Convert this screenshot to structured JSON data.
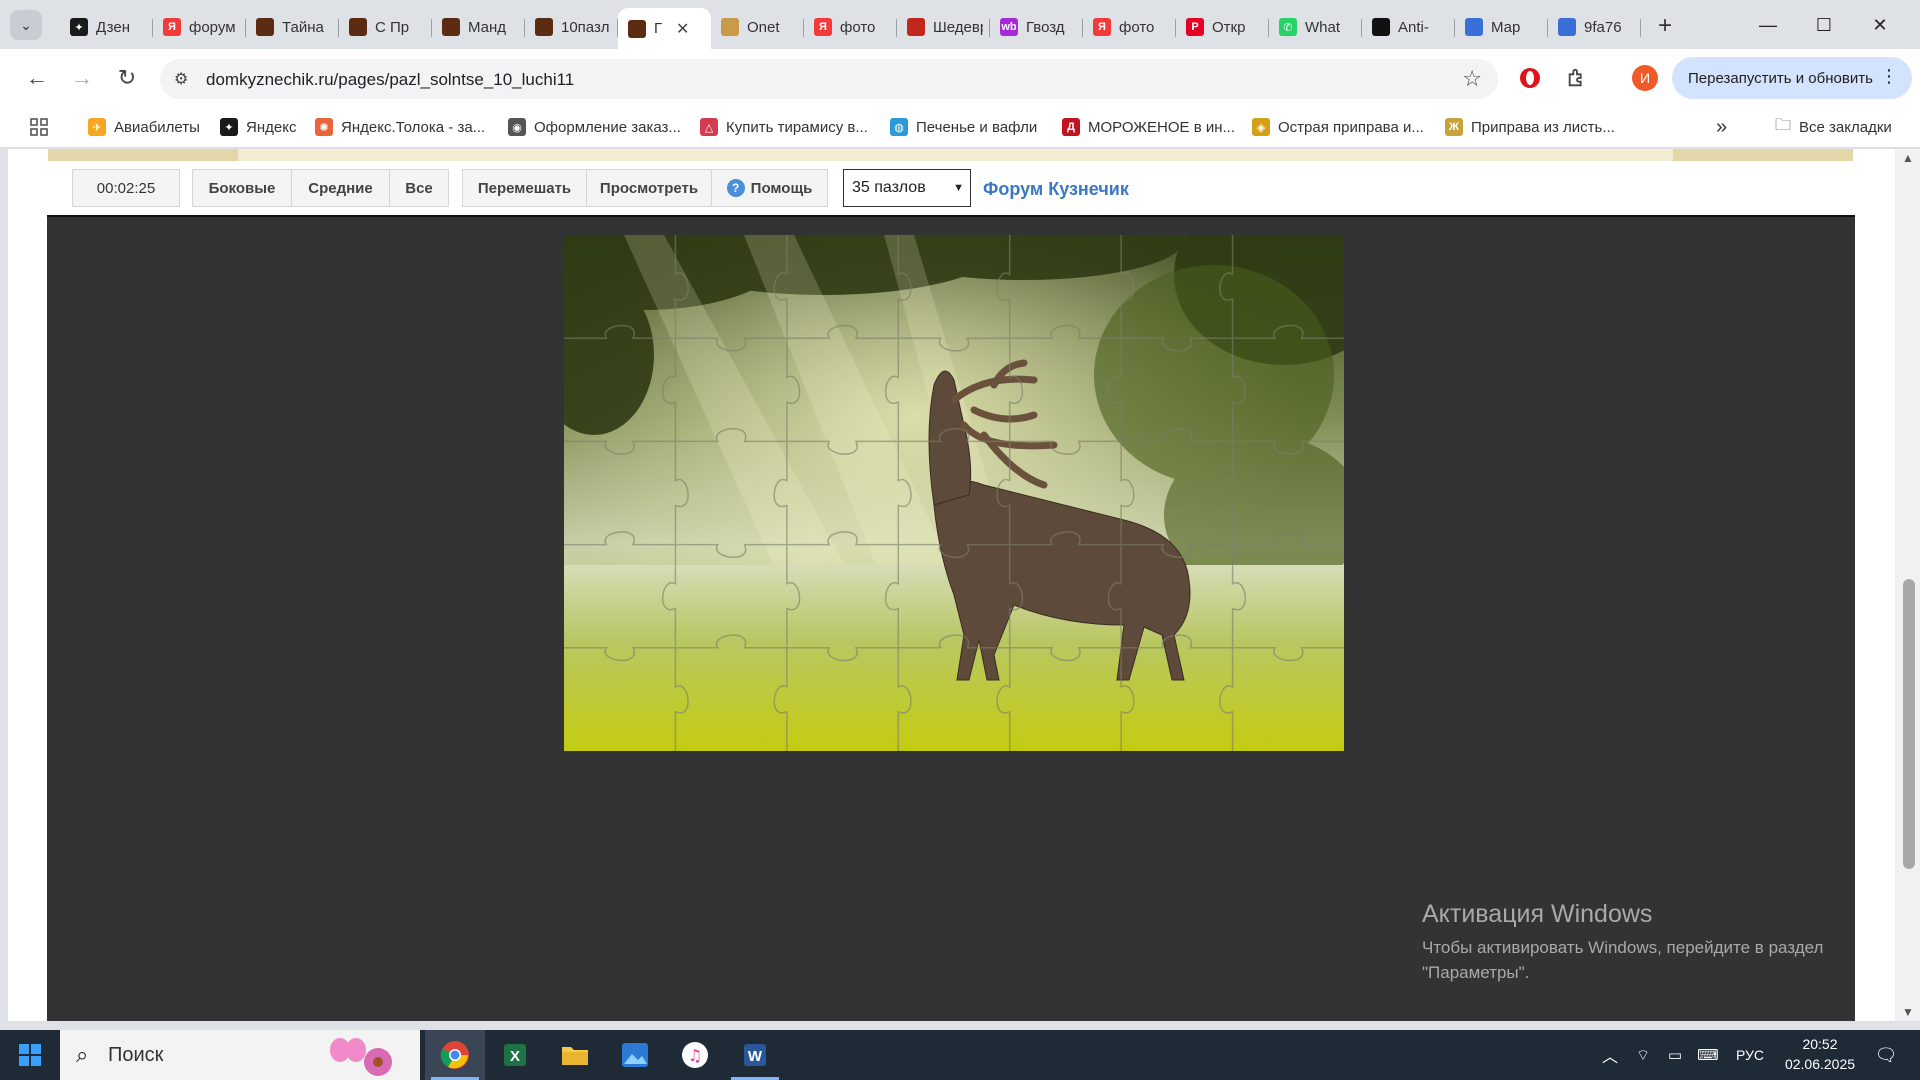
{
  "browser": {
    "tabs": [
      {
        "title": "Дзен",
        "fav_color": "#1a1a1a",
        "fav_glyph": "✦"
      },
      {
        "title": "форум",
        "fav_color": "#f33a3a",
        "fav_glyph": "Я"
      },
      {
        "title": "Тайна",
        "fav_color": "#5b2b12",
        "fav_glyph": ""
      },
      {
        "title": "С Пр",
        "fav_color": "#5b2b12",
        "fav_glyph": ""
      },
      {
        "title": "Манд",
        "fav_color": "#5b2b12",
        "fav_glyph": ""
      },
      {
        "title": "10пазл",
        "fav_color": "#5b2b12",
        "fav_glyph": ""
      },
      {
        "title": "Г",
        "fav_color": "#5b2b12",
        "fav_glyph": "",
        "active": true
      },
      {
        "title": "Onet",
        "fav_color": "#c99a4a",
        "fav_glyph": ""
      },
      {
        "title": "фото",
        "fav_color": "#f33a3a",
        "fav_glyph": "Я"
      },
      {
        "title": "Шедевр",
        "fav_color": "#c0271d",
        "fav_glyph": ""
      },
      {
        "title": "Гвозд",
        "fav_color": "#a52ad6",
        "fav_glyph": "wb"
      },
      {
        "title": "фото",
        "fav_color": "#f33a3a",
        "fav_glyph": "Я"
      },
      {
        "title": "Откр",
        "fav_color": "#e60023",
        "fav_glyph": "P"
      },
      {
        "title": "What",
        "fav_color": "#25d366",
        "fav_glyph": "✆"
      },
      {
        "title": "Anti-",
        "fav_color": "#111111",
        "fav_glyph": ""
      },
      {
        "title": "Мар",
        "fav_color": "#3b6fd8",
        "fav_glyph": ""
      },
      {
        "title": "9fa76",
        "fav_color": "#3b6fd8",
        "fav_glyph": ""
      }
    ],
    "url": "domkyznechik.ru/pages/pazl_solntse_10_luchi11",
    "restart_label": "Перезапустить и обновить",
    "profile_letter": "И",
    "bookmarks": [
      {
        "label": "Авиабилеты",
        "color": "#f5a623",
        "glyph": "✈"
      },
      {
        "label": "Яндекс",
        "color": "#1a1a1a",
        "glyph": "✦"
      },
      {
        "label": "Яндекс.Толока - за...",
        "color": "#e8643c",
        "glyph": "✺"
      },
      {
        "label": "Оформление заказ...",
        "color": "#555555",
        "glyph": "◉"
      },
      {
        "label": "Купить тирамису в...",
        "color": "#d33b4e",
        "glyph": "△"
      },
      {
        "label": "Печенье и вафли",
        "color": "#2b9ad6",
        "glyph": "◍"
      },
      {
        "label": "МОРОЖЕНОЕ в ин...",
        "color": "#c1121f",
        "glyph": "Д"
      },
      {
        "label": "Острая приправа и...",
        "color": "#d4a017",
        "glyph": "◈"
      },
      {
        "label": "Приправа из листь...",
        "color": "#c8a23c",
        "glyph": "Ж"
      }
    ],
    "all_bookmarks": "Все закладки",
    "more": "»"
  },
  "puzzle_page": {
    "timer": "00:02:25",
    "buttons": {
      "side": "Боковые",
      "middle": "Средние",
      "all": "Все",
      "shuffle": "Перемешать",
      "preview": "Просмотреть",
      "help": "Помощь"
    },
    "pieces_selected": "35 пазлов",
    "forum_link": "Форум Кузнечик",
    "grid": {
      "cols": 7,
      "rows": 5
    }
  },
  "activation": {
    "title": "Активация Windows",
    "line1": "Чтобы активировать Windows, перейдите в раздел",
    "line2": "\"Параметры\"."
  },
  "taskbar": {
    "search_placeholder": "Поиск",
    "language": "РУС",
    "time": "20:52",
    "date": "02.06.2025"
  }
}
